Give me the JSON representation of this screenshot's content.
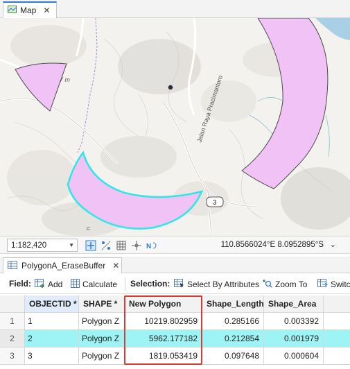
{
  "map_tab": {
    "label": "Map",
    "close": "✕",
    "icon": "map-icon"
  },
  "map_labels": {
    "road_label": "Jalan Raya Pracimantoro",
    "route_badge": "3",
    "contour_label": "7 m",
    "edge_label": "n"
  },
  "status_bar": {
    "scale": "1:182,420",
    "coordinates": "110.8566024°E 8.0952895°S"
  },
  "table_tab": {
    "label": "PolygonA_EraseBuffer",
    "close": "✕",
    "icon": "table-icon"
  },
  "toolbar": {
    "field_label": "Field:",
    "add_label": "Add",
    "calculate_label": "Calculate",
    "selection_label": "Selection:",
    "select_by_attributes_label": "Select By Attributes",
    "zoom_to_label": "Zoom To",
    "switch_label": "Switc"
  },
  "table": {
    "columns": [
      "OBJECTID *",
      "SHAPE *",
      "New Polygon",
      "Shape_Length",
      "Shape_Area"
    ],
    "rows": [
      {
        "num": "1",
        "objectid": "1",
        "shape": "Polygon Z",
        "new_polygon": "10219.802959",
        "shape_length": "0.285166",
        "shape_area": "0.003392"
      },
      {
        "num": "2",
        "objectid": "2",
        "shape": "Polygon Z",
        "new_polygon": "5962.177182",
        "shape_length": "0.212854",
        "shape_area": "0.001979"
      },
      {
        "num": "3",
        "objectid": "3",
        "shape": "Polygon Z",
        "new_polygon": "1819.053419",
        "shape_length": "0.097648",
        "shape_area": "0.000604"
      }
    ],
    "selected_row": 2
  },
  "colors": {
    "polygon_fill": "#f0c2f5",
    "selection_outline": "#33e6e6",
    "selected_row": "#9ef3f4",
    "highlight_box": "#d93a32",
    "water": "#a9cfe6"
  }
}
